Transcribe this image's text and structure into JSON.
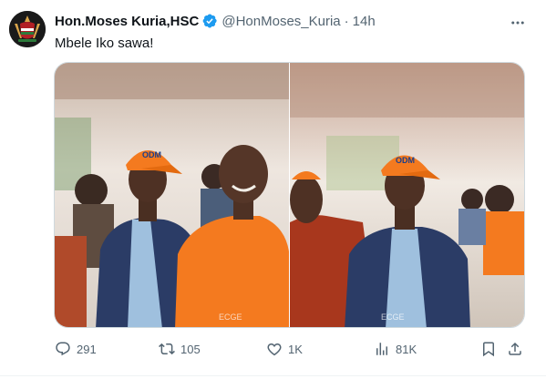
{
  "author": {
    "display_name": "Hon.Moses Kuria,HSC",
    "handle": "@HonMoses_Kuria",
    "separator": "·",
    "time": "14h",
    "avatar_icon": "coat-of-arms-icon",
    "verified_icon": "verified-badge-icon"
  },
  "tweet": {
    "text": "Mbele Iko sawa!"
  },
  "media": {
    "photos": [
      {
        "cap_text": "ODM",
        "watermark": "ECGE"
      },
      {
        "cap_text": "ODM",
        "watermark": "ECGE"
      }
    ]
  },
  "actions": {
    "replies": "291",
    "reposts": "105",
    "likes": "1K",
    "views": "81K"
  },
  "colors": {
    "text_primary": "#0f1419",
    "text_secondary": "#536471",
    "verified_blue": "#1d9bf0",
    "orange": "#f47a1f"
  }
}
